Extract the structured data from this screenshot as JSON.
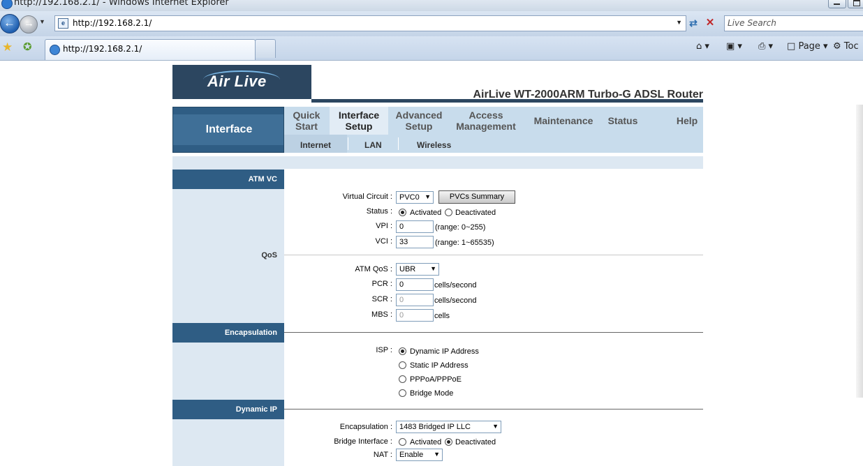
{
  "browser": {
    "window_title": "http://192.168.2.1/ - Windows Internet Explorer",
    "address": "http://192.168.2.1/",
    "search_placeholder": "Live Search",
    "tab_label": "http://192.168.2.1/",
    "commands": {
      "page": "Page",
      "tools": "Toc"
    }
  },
  "router": {
    "logo": "Air Live",
    "title": "AirLive WT-2000ARM Turbo-G ADSL Router",
    "section": "Interface",
    "menu": [
      {
        "line1": "Quick",
        "line2": "Start"
      },
      {
        "line1": "Interface",
        "line2": "Setup"
      },
      {
        "line1": "Advanced",
        "line2": "Setup"
      },
      {
        "line1": "Access",
        "line2": "Management"
      },
      {
        "line1": "Maintenance",
        "line2": ""
      },
      {
        "line1": "Status",
        "line2": ""
      },
      {
        "line1": "Help",
        "line2": ""
      }
    ],
    "submenu": [
      "Internet",
      "LAN",
      "Wireless"
    ]
  },
  "sections": {
    "atm_vc": "ATM VC",
    "qos": "QoS",
    "encapsulation": "Encapsulation",
    "dynamic_ip": "Dynamic IP"
  },
  "atm": {
    "virtual_circuit_label": "Virtual Circuit :",
    "virtual_circuit_value": "PVC0",
    "pvc_summary": "PVCs Summary",
    "status_label": "Status :",
    "status_activated": "Activated",
    "status_deactivated": "Deactivated",
    "vpi_label": "VPI :",
    "vpi_value": "0",
    "vpi_range": "(range: 0~255)",
    "vci_label": "VCI :",
    "vci_value": "33",
    "vci_range": "(range: 1~65535)"
  },
  "qos": {
    "atm_qos_label": "ATM QoS :",
    "atm_qos_value": "UBR",
    "pcr_label": "PCR :",
    "pcr_value": "0",
    "scr_label": "SCR :",
    "scr_value": "0",
    "mbs_label": "MBS :",
    "mbs_value": "0",
    "unit_cells_second": "cells/second",
    "unit_cells": "cells"
  },
  "isp": {
    "label": "ISP :",
    "options": [
      "Dynamic IP Address",
      "Static IP Address",
      "PPPoA/PPPoE",
      "Bridge Mode"
    ],
    "selected_index": 0
  },
  "dynamic": {
    "encap_label": "Encapsulation :",
    "encap_value": "1483 Bridged IP LLC",
    "bridge_label": "Bridge Interface :",
    "bridge_activated": "Activated",
    "bridge_deactivated": "Deactivated",
    "nat_label": "NAT :",
    "nat_value": "Enable"
  }
}
